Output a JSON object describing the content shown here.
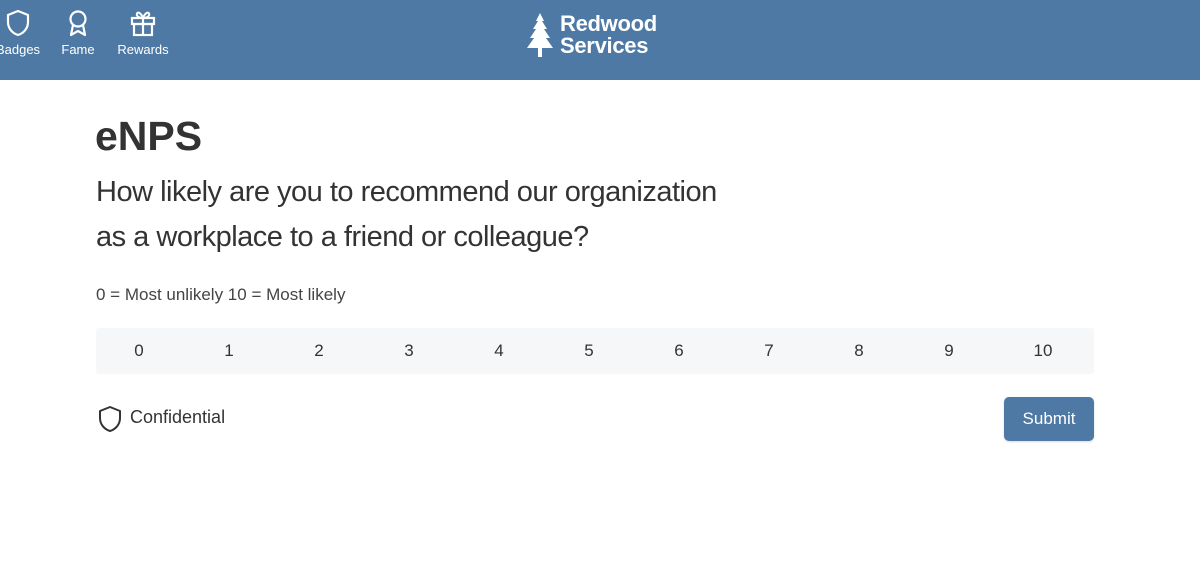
{
  "header": {
    "nav": [
      {
        "label": "Badges",
        "icon": "shield-icon"
      },
      {
        "label": "Fame",
        "icon": "award-ribbon-icon"
      },
      {
        "label": "Rewards",
        "icon": "gift-icon"
      }
    ],
    "brand": {
      "line1": "Redwood",
      "line2": "Services",
      "icon": "pine-tree-icon"
    },
    "background_color": "#4d79a4"
  },
  "survey": {
    "title": "eNPS",
    "question_line1": "How likely are you to recommend our organization",
    "question_line2": "as a workplace to a friend or colleague?",
    "scale_hint": "0 = Most unlikely 10 = Most likely",
    "scale_options": [
      "0",
      "1",
      "2",
      "3",
      "4",
      "5",
      "6",
      "7",
      "8",
      "9",
      "10"
    ],
    "selected_value": null
  },
  "footer": {
    "confidential_label": "Confidential",
    "confidential_icon": "shield-icon",
    "submit_label": "Submit",
    "submit_color": "#4d79a4"
  }
}
